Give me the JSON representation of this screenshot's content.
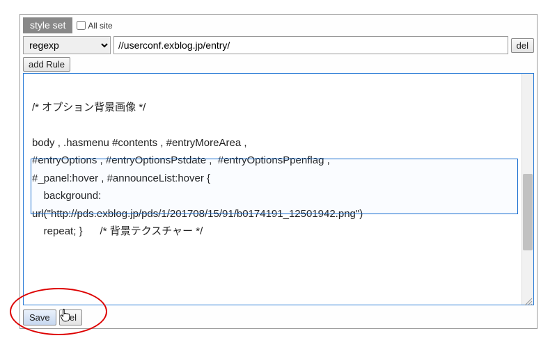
{
  "header": {
    "styleSetLabel": "style set",
    "allSiteLabel": "All site"
  },
  "rule": {
    "matchType": "regexp",
    "urlPattern": "//userconf.exblog.jp/entry/",
    "delLabel": "del",
    "addRuleLabel": "add Rule"
  },
  "css": {
    "line1": "/* オプション背景画像 */",
    "line2": "body , .hasmenu #contents , #entryMoreArea ,",
    "line3": "#entryOptions , #entryOptionsPstdate ,  #entryOptionsPpenflag ,",
    "line4": "#_panel:hover , #announceList:hover {",
    "line5": "    background:",
    "line6": "url(\"http://pds.exblog.jp/pds/1/201708/15/91/b0174191_12501942.png\")",
    "line7": "    repeat; }      /* 背景テクスチャー */"
  },
  "footer": {
    "saveLabel": "Save",
    "delLabel": "del"
  }
}
